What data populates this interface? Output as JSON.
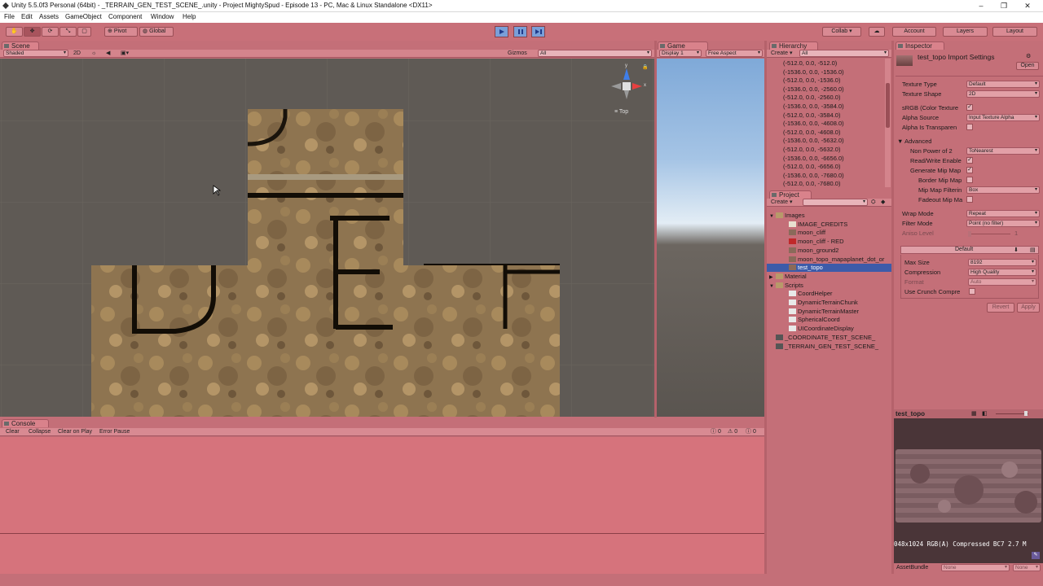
{
  "window": {
    "title": "Unity 5.5.0f3 Personal (64bit) - _TERRAIN_GEN_TEST_SCENE_.unity - Project MightySpud - Episode 13 - PC, Mac & Linux Standalone <DX11>",
    "minimize": "–",
    "maximize": "❐",
    "close": "✕"
  },
  "menu": [
    "File",
    "Edit",
    "Assets",
    "GameObject",
    "Component",
    "Window",
    "Help"
  ],
  "toolbar": {
    "pivot_label": "Pivot",
    "global_label": "Global",
    "collab_label": "Collab ▾",
    "account_label": "Account",
    "layers_label": "Layers",
    "layout_label": "Layout"
  },
  "scene": {
    "tab": "Scene",
    "shading": "Shaded",
    "mode_2d": "2D",
    "gizmos": "Gizmos",
    "search_placeholder": "All",
    "orientation": "Top",
    "axis_y": "y",
    "axis_x": "x"
  },
  "game": {
    "tab": "Game",
    "display": "Display 1",
    "aspect": "Free Aspect"
  },
  "hierarchy": {
    "tab": "Hierarchy",
    "create": "Create ▾",
    "search_placeholder": "All",
    "items": [
      "(-512.0, 0.0, -512.0)",
      "(-1536.0, 0.0, -1536.0)",
      "(-512.0, 0.0, -1536.0)",
      "(-1536.0, 0.0, -2560.0)",
      "(-512.0, 0.0, -2560.0)",
      "(-1536.0, 0.0, -3584.0)",
      "(-512.0, 0.0, -3584.0)",
      "(-1536.0, 0.0, -4608.0)",
      "(-512.0, 0.0, -4608.0)",
      "(-1536.0, 0.0, -5632.0)",
      "(-512.0, 0.0, -5632.0)",
      "(-1536.0, 0.0, -6656.0)",
      "(-512.0, 0.0, -6656.0)",
      "(-1536.0, 0.0, -7680.0)",
      "(-512.0, 0.0, -7680.0)"
    ]
  },
  "project": {
    "tab": "Project",
    "create": "Create ▾",
    "items": [
      {
        "label": "Images",
        "icon": "folder-icon",
        "level": 0,
        "fold": "▼"
      },
      {
        "label": "IMAGE_CREDITS",
        "icon": "text-file-icon",
        "level": 1,
        "fold": ""
      },
      {
        "label": "moon_cliff",
        "icon": "texture-icon",
        "level": 1,
        "fold": ""
      },
      {
        "label": "moon_cliff - RED",
        "icon": "texture-red-icon",
        "level": 1,
        "fold": ""
      },
      {
        "label": "moon_ground2",
        "icon": "texture-icon",
        "level": 1,
        "fold": ""
      },
      {
        "label": "moon_topo_mapaplanet_dot_or",
        "icon": "texture-icon",
        "level": 1,
        "fold": ""
      },
      {
        "label": "test_topo",
        "icon": "texture-icon",
        "level": 1,
        "fold": "",
        "selected": true
      },
      {
        "label": "Material",
        "icon": "folder-icon",
        "level": 0,
        "fold": "▶"
      },
      {
        "label": "Scripts",
        "icon": "folder-icon",
        "level": 0,
        "fold": "▼"
      },
      {
        "label": "CoordHelper",
        "icon": "script-icon",
        "level": 1,
        "fold": ""
      },
      {
        "label": "DynamicTerrainChunk",
        "icon": "script-icon",
        "level": 1,
        "fold": ""
      },
      {
        "label": "DynamicTerrainMaster",
        "icon": "script-icon",
        "level": 1,
        "fold": ""
      },
      {
        "label": "SphericalCoord",
        "icon": "script-icon",
        "level": 1,
        "fold": ""
      },
      {
        "label": "UICoordinateDisplay",
        "icon": "script-icon",
        "level": 1,
        "fold": ""
      },
      {
        "label": "_COORDINATE_TEST_SCENE_",
        "icon": "scene-icon",
        "level": 0,
        "fold": ""
      },
      {
        "label": "_TERRAIN_GEN_TEST_SCENE_",
        "icon": "scene-icon",
        "level": 0,
        "fold": ""
      }
    ]
  },
  "inspector": {
    "tab": "Inspector",
    "title": "test_topo Import Settings",
    "open_label": "Open",
    "texture_type_label": "Texture Type",
    "texture_type_value": "Default",
    "texture_shape_label": "Texture Shape",
    "texture_shape_value": "2D",
    "srgb_label": "sRGB (Color Texture",
    "alpha_source_label": "Alpha Source",
    "alpha_source_value": "Input Texture Alpha",
    "alpha_transparency_label": "Alpha Is Transparen",
    "advanced_label": "Advanced",
    "npot_label": "Non Power of 2",
    "npot_value": "ToNearest",
    "rw_label": "Read/Write Enable",
    "genmip_label": "Generate Mip Map",
    "bordermip_label": "Border Mip Map",
    "mipfilter_label": "Mip Map Filterin",
    "mipfilter_value": "Box",
    "fadeout_label": "Fadeout Mip Ma",
    "wrap_label": "Wrap Mode",
    "wrap_value": "Repeat",
    "filter_label": "Filter Mode",
    "filter_value": "Point (no filter)",
    "aniso_label": "Aniso Level",
    "aniso_value": "1",
    "platform_tab": "Default",
    "maxsize_label": "Max Size",
    "maxsize_value": "8192",
    "compression_label": "Compression",
    "compression_value": "High Quality",
    "format_label": "Format",
    "format_value": "Auto",
    "crunch_label": "Use Crunch Compre",
    "revert_label": "Revert",
    "apply_label": "Apply"
  },
  "preview": {
    "title": "test_topo",
    "info": "048x1024  RGB(A) Compressed BC7   2.7 M",
    "assetbundle_label": "AssetBundle",
    "assetbundle_value": "None",
    "variant_value": "None"
  },
  "console": {
    "tab": "Console",
    "clear": "Clear",
    "collapse": "Collapse",
    "clear_on_play": "Clear on Play",
    "error_pause": "Error Pause",
    "info_count": "0",
    "warn_count": "0",
    "error_count": "0"
  },
  "colors": {
    "tint": "#c46f78",
    "selection": "#3d5ba9",
    "play_active": "#7a9fd8"
  }
}
